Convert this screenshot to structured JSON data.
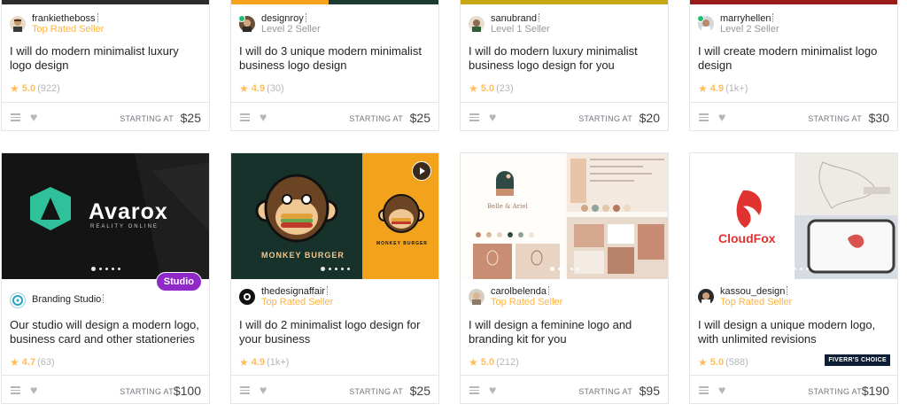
{
  "cards_row1": [
    {
      "seller": "frankietheboss",
      "level": "Top Rated Seller",
      "level_type": "top",
      "title": "I will do modern minimalist luxury logo design",
      "rating": "5.0",
      "reviews": "(922)",
      "starting": "STARTING AT",
      "price": "$25",
      "top_bar_color": "#2b2b2b"
    },
    {
      "seller": "designroy",
      "level": "Level 2 Seller",
      "level_type": "normal",
      "title": "I will do 3 unique modern minimalist business logo design",
      "rating": "4.9",
      "reviews": "(30)",
      "starting": "STARTING AT",
      "price": "$25",
      "top_bar_color": "#1b3b33"
    },
    {
      "seller": "sanubrand",
      "level": "Level 1 Seller",
      "level_type": "normal",
      "title": "I will do modern luxury minimalist business logo design for you",
      "rating": "5.0",
      "reviews": "(23)",
      "starting": "STARTING AT",
      "price": "$20",
      "top_bar_color": "#c6a714"
    },
    {
      "seller": "marryhellen",
      "level": "Level 2 Seller",
      "level_type": "normal",
      "title": "I will create modern minimalist logo design",
      "rating": "4.9",
      "reviews": "(1k+)",
      "starting": "STARTING AT",
      "price": "$30",
      "top_bar_color": "#9b1b1b"
    }
  ],
  "cards_row2": [
    {
      "seller": "Branding Studio",
      "level": "",
      "title": "Our studio will design a modern logo, business card and other stationeries",
      "rating": "4.7",
      "reviews": "(63)",
      "starting": "STARTING AT",
      "price": "$100",
      "badge": "Studio",
      "thumb_logo": "Avarox",
      "thumb_sub": "REALITY ONLINE"
    },
    {
      "seller": "thedesignaffair",
      "level": "Top Rated Seller",
      "level_type": "top",
      "title": "I will do 2 minimalist logo design for your business",
      "rating": "4.9",
      "reviews": "(1k+)",
      "starting": "STARTING AT",
      "price": "$25",
      "thumb_text": "MONKEY BURGER",
      "thumb_text_small": "MONKEY BURGER"
    },
    {
      "seller": "carolbelenda",
      "level": "Top Rated Seller",
      "level_type": "top",
      "title": "I will design a feminine logo and branding kit for you",
      "rating": "5.0",
      "reviews": "(212)",
      "starting": "STARTING AT",
      "price": "$95",
      "thumb_text": "Belle & Ariel"
    },
    {
      "seller": "kassou_design",
      "level": "Top Rated Seller",
      "level_type": "top",
      "title": "I will design a unique modern logo, with unlimited revisions",
      "rating": "5.0",
      "reviews": "(588)",
      "starting": "STARTING AT",
      "price": "$190",
      "choice": "FIVERR'S CHOICE",
      "thumb_logo": "CloudFox"
    }
  ],
  "colors": {
    "star": "#ffbe5b",
    "top_rated": "#ffb33e",
    "online": "#1dbf73",
    "studio_badge": "#8f2ac8"
  }
}
